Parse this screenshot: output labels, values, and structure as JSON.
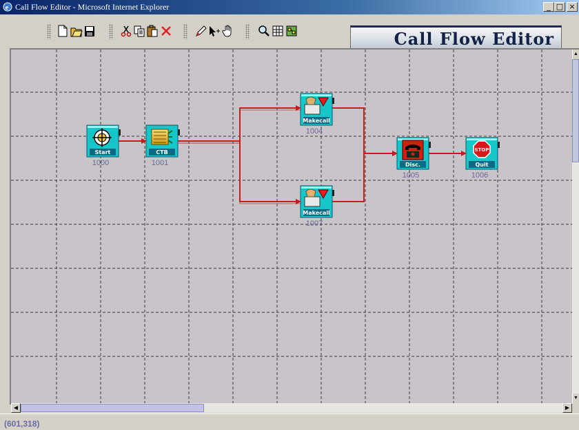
{
  "window": {
    "title": "Call Flow Editor - Microsoft Internet Explorer",
    "controls": {
      "minimize": "_",
      "maximize": "□",
      "close": "×"
    }
  },
  "toolbar": {
    "groups": [
      [
        "new-icon",
        "open-icon",
        "save-icon"
      ],
      [
        "cut-icon",
        "copy-icon",
        "paste-icon",
        "delete-icon"
      ],
      [
        "draw-link-icon",
        "select-pointer-icon",
        "hand-pan-icon"
      ],
      [
        "zoom-icon",
        "grid-icon",
        "properties-icon"
      ]
    ]
  },
  "logo": {
    "text": "Call Flow Editor"
  },
  "flow": {
    "nodes": [
      {
        "id": "1000",
        "caption": "Start",
        "type": "start"
      },
      {
        "id": "1001",
        "caption": "CTB",
        "type": "ctb"
      },
      {
        "id": "1004",
        "caption": "Makecall",
        "type": "makecall"
      },
      {
        "id": "1007",
        "caption": "Makecall",
        "type": "makecall"
      },
      {
        "id": "1005",
        "caption": "Disc.",
        "type": "disconnect"
      },
      {
        "id": "1006",
        "caption": "Quit",
        "type": "quit"
      }
    ],
    "links": [
      {
        "from": "1000",
        "to": "1001"
      },
      {
        "from": "1001",
        "to": "1004"
      },
      {
        "from": "1001",
        "to": "1007"
      },
      {
        "from": "1004",
        "to": "1005"
      },
      {
        "from": "1007",
        "to": "1005"
      },
      {
        "from": "1005",
        "to": "1006"
      }
    ],
    "link_color": "#cc1a1a",
    "quit_sign_text": "STOP"
  },
  "colors": {
    "canvas": "#c9c3ca",
    "grid": "#3a3a3a",
    "node_fill": "#17c6c9",
    "title_bar": "#0a246a"
  },
  "status": {
    "coords": "(601,318)"
  }
}
